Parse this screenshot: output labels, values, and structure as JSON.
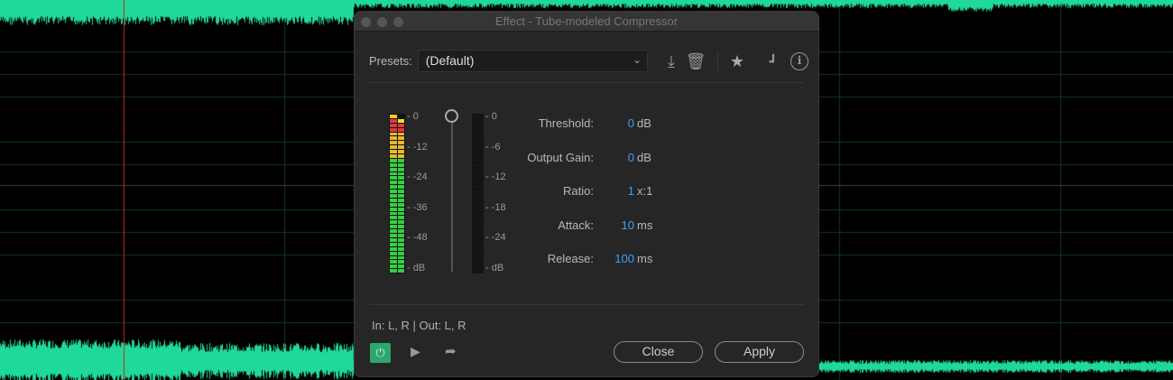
{
  "background": {
    "waveform_color": "#1fd99a",
    "playhead_color": "#d0201a"
  },
  "dialog": {
    "title": "Effect - Tube-modeled Compressor",
    "presets_label": "Presets:",
    "preset_value": "(Default)",
    "toolbar_icons": [
      "save-preset-icon",
      "delete-preset-icon",
      "favorite-star-icon",
      "routing-icon",
      "info-icon"
    ],
    "input_meter": {
      "scale": [
        "0",
        "-12",
        "-24",
        "-36",
        "-48",
        "dB"
      ]
    },
    "output_meter": {
      "scale": [
        "0",
        "-6",
        "-12",
        "-18",
        "-24",
        "dB"
      ]
    },
    "params": [
      {
        "label": "Threshold:",
        "value": "0",
        "unit": "dB"
      },
      {
        "label": "Output Gain:",
        "value": "0",
        "unit": "dB"
      },
      {
        "label": "Ratio:",
        "value": "1",
        "unit": "x:1"
      },
      {
        "label": "Attack:",
        "value": "10",
        "unit": "ms"
      },
      {
        "label": "Release:",
        "value": "100",
        "unit": "ms"
      }
    ],
    "io_text": "In: L, R | Out: L, R",
    "close_label": "Close",
    "apply_label": "Apply",
    "accent": "#3ba0ff"
  }
}
